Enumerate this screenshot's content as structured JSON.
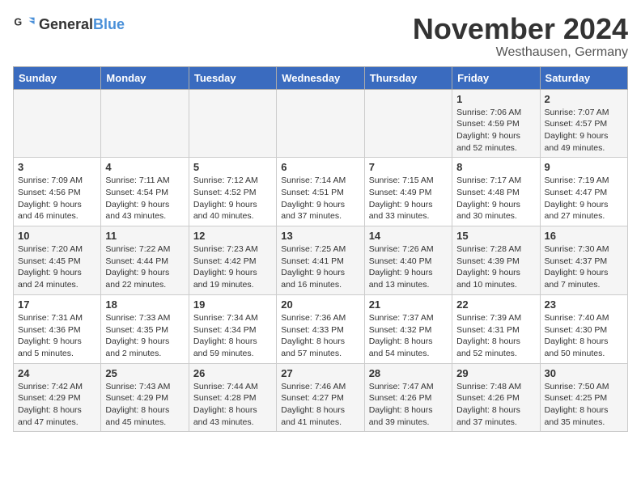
{
  "logo": {
    "general": "General",
    "blue": "Blue"
  },
  "title": "November 2024",
  "location": "Westhausen, Germany",
  "days_header": [
    "Sunday",
    "Monday",
    "Tuesday",
    "Wednesday",
    "Thursday",
    "Friday",
    "Saturday"
  ],
  "weeks": [
    [
      {
        "day": "",
        "info": ""
      },
      {
        "day": "",
        "info": ""
      },
      {
        "day": "",
        "info": ""
      },
      {
        "day": "",
        "info": ""
      },
      {
        "day": "",
        "info": ""
      },
      {
        "day": "1",
        "info": "Sunrise: 7:06 AM\nSunset: 4:59 PM\nDaylight: 9 hours\nand 52 minutes."
      },
      {
        "day": "2",
        "info": "Sunrise: 7:07 AM\nSunset: 4:57 PM\nDaylight: 9 hours\nand 49 minutes."
      }
    ],
    [
      {
        "day": "3",
        "info": "Sunrise: 7:09 AM\nSunset: 4:56 PM\nDaylight: 9 hours\nand 46 minutes."
      },
      {
        "day": "4",
        "info": "Sunrise: 7:11 AM\nSunset: 4:54 PM\nDaylight: 9 hours\nand 43 minutes."
      },
      {
        "day": "5",
        "info": "Sunrise: 7:12 AM\nSunset: 4:52 PM\nDaylight: 9 hours\nand 40 minutes."
      },
      {
        "day": "6",
        "info": "Sunrise: 7:14 AM\nSunset: 4:51 PM\nDaylight: 9 hours\nand 37 minutes."
      },
      {
        "day": "7",
        "info": "Sunrise: 7:15 AM\nSunset: 4:49 PM\nDaylight: 9 hours\nand 33 minutes."
      },
      {
        "day": "8",
        "info": "Sunrise: 7:17 AM\nSunset: 4:48 PM\nDaylight: 9 hours\nand 30 minutes."
      },
      {
        "day": "9",
        "info": "Sunrise: 7:19 AM\nSunset: 4:47 PM\nDaylight: 9 hours\nand 27 minutes."
      }
    ],
    [
      {
        "day": "10",
        "info": "Sunrise: 7:20 AM\nSunset: 4:45 PM\nDaylight: 9 hours\nand 24 minutes."
      },
      {
        "day": "11",
        "info": "Sunrise: 7:22 AM\nSunset: 4:44 PM\nDaylight: 9 hours\nand 22 minutes."
      },
      {
        "day": "12",
        "info": "Sunrise: 7:23 AM\nSunset: 4:42 PM\nDaylight: 9 hours\nand 19 minutes."
      },
      {
        "day": "13",
        "info": "Sunrise: 7:25 AM\nSunset: 4:41 PM\nDaylight: 9 hours\nand 16 minutes."
      },
      {
        "day": "14",
        "info": "Sunrise: 7:26 AM\nSunset: 4:40 PM\nDaylight: 9 hours\nand 13 minutes."
      },
      {
        "day": "15",
        "info": "Sunrise: 7:28 AM\nSunset: 4:39 PM\nDaylight: 9 hours\nand 10 minutes."
      },
      {
        "day": "16",
        "info": "Sunrise: 7:30 AM\nSunset: 4:37 PM\nDaylight: 9 hours\nand 7 minutes."
      }
    ],
    [
      {
        "day": "17",
        "info": "Sunrise: 7:31 AM\nSunset: 4:36 PM\nDaylight: 9 hours\nand 5 minutes."
      },
      {
        "day": "18",
        "info": "Sunrise: 7:33 AM\nSunset: 4:35 PM\nDaylight: 9 hours\nand 2 minutes."
      },
      {
        "day": "19",
        "info": "Sunrise: 7:34 AM\nSunset: 4:34 PM\nDaylight: 8 hours\nand 59 minutes."
      },
      {
        "day": "20",
        "info": "Sunrise: 7:36 AM\nSunset: 4:33 PM\nDaylight: 8 hours\nand 57 minutes."
      },
      {
        "day": "21",
        "info": "Sunrise: 7:37 AM\nSunset: 4:32 PM\nDaylight: 8 hours\nand 54 minutes."
      },
      {
        "day": "22",
        "info": "Sunrise: 7:39 AM\nSunset: 4:31 PM\nDaylight: 8 hours\nand 52 minutes."
      },
      {
        "day": "23",
        "info": "Sunrise: 7:40 AM\nSunset: 4:30 PM\nDaylight: 8 hours\nand 50 minutes."
      }
    ],
    [
      {
        "day": "24",
        "info": "Sunrise: 7:42 AM\nSunset: 4:29 PM\nDaylight: 8 hours\nand 47 minutes."
      },
      {
        "day": "25",
        "info": "Sunrise: 7:43 AM\nSunset: 4:29 PM\nDaylight: 8 hours\nand 45 minutes."
      },
      {
        "day": "26",
        "info": "Sunrise: 7:44 AM\nSunset: 4:28 PM\nDaylight: 8 hours\nand 43 minutes."
      },
      {
        "day": "27",
        "info": "Sunrise: 7:46 AM\nSunset: 4:27 PM\nDaylight: 8 hours\nand 41 minutes."
      },
      {
        "day": "28",
        "info": "Sunrise: 7:47 AM\nSunset: 4:26 PM\nDaylight: 8 hours\nand 39 minutes."
      },
      {
        "day": "29",
        "info": "Sunrise: 7:48 AM\nSunset: 4:26 PM\nDaylight: 8 hours\nand 37 minutes."
      },
      {
        "day": "30",
        "info": "Sunrise: 7:50 AM\nSunset: 4:25 PM\nDaylight: 8 hours\nand 35 minutes."
      }
    ]
  ]
}
